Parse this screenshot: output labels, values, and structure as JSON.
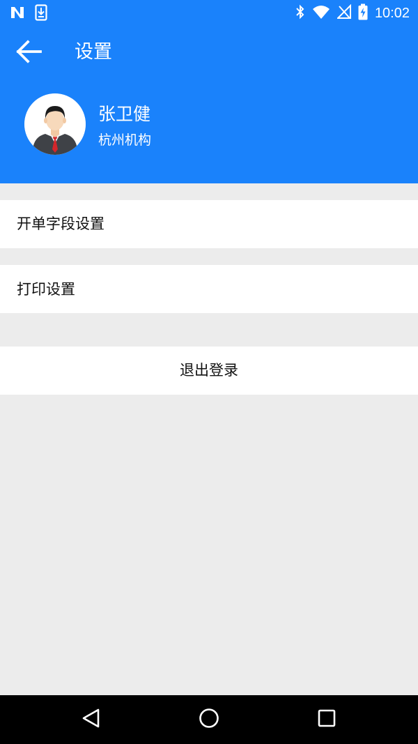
{
  "status_bar": {
    "time": "10:02",
    "left_icons": [
      "notification-n-icon",
      "download-icon"
    ],
    "right_icons": [
      "bluetooth-icon",
      "wifi-icon",
      "no-signal-icon",
      "battery-charging-icon"
    ]
  },
  "header": {
    "title": "设置",
    "back_icon": "arrow-back-icon"
  },
  "user": {
    "name": "张卫健",
    "org": "杭州机构",
    "avatar_icon": "user-avatar-icon"
  },
  "settings": {
    "items": [
      {
        "label": "开单字段设置"
      },
      {
        "label": "打印设置"
      }
    ],
    "logout_label": "退出登录"
  },
  "nav_bar": {
    "icons": [
      "back-triangle-icon",
      "home-circle-icon",
      "recents-square-icon"
    ]
  },
  "colors": {
    "primary": "#1a82fb",
    "background": "#ececec",
    "row": "#ffffff",
    "nav": "#000000"
  }
}
